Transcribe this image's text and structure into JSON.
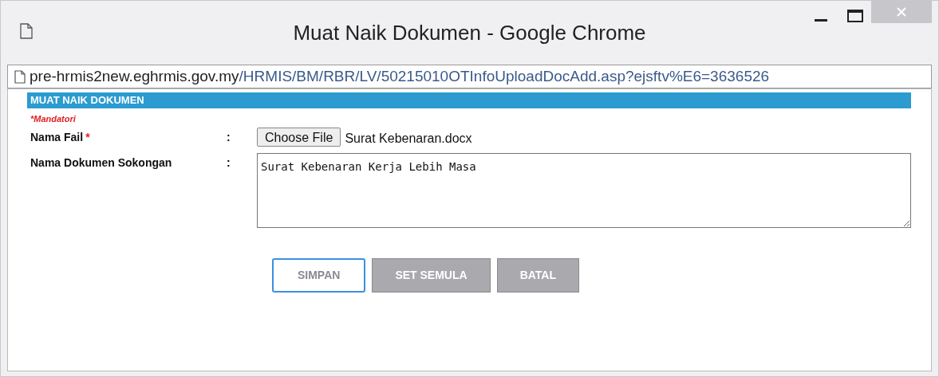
{
  "window": {
    "title": "Muat Naik Dokumen - Google Chrome"
  },
  "address_bar": {
    "host": "pre-hrmis2new.eghrmis.gov.my",
    "path": "/HRMIS/BM/RBR/LV/50215010OTInfoUploadDocAdd.asp?ejsftv%E6=3636526"
  },
  "panel": {
    "title": "MUAT NAIK DOKUMEN",
    "mandatory_note": "*Mandatori"
  },
  "fields": [
    {
      "kind": "file",
      "label": "Nama Fail",
      "required_mark": "*",
      "separator": ":",
      "button": "Choose File",
      "value": "Surat Kebenaran.docx"
    },
    {
      "kind": "textarea",
      "label": "Nama Dokumen Sokongan",
      "separator": ":",
      "value": "Surat Kebenaran Kerja Lebih Masa"
    }
  ],
  "buttons": [
    {
      "label": "SIMPAN",
      "focused": true
    },
    {
      "label": "SET SEMULA",
      "focused": false
    },
    {
      "label": "BATAL",
      "focused": false
    }
  ]
}
